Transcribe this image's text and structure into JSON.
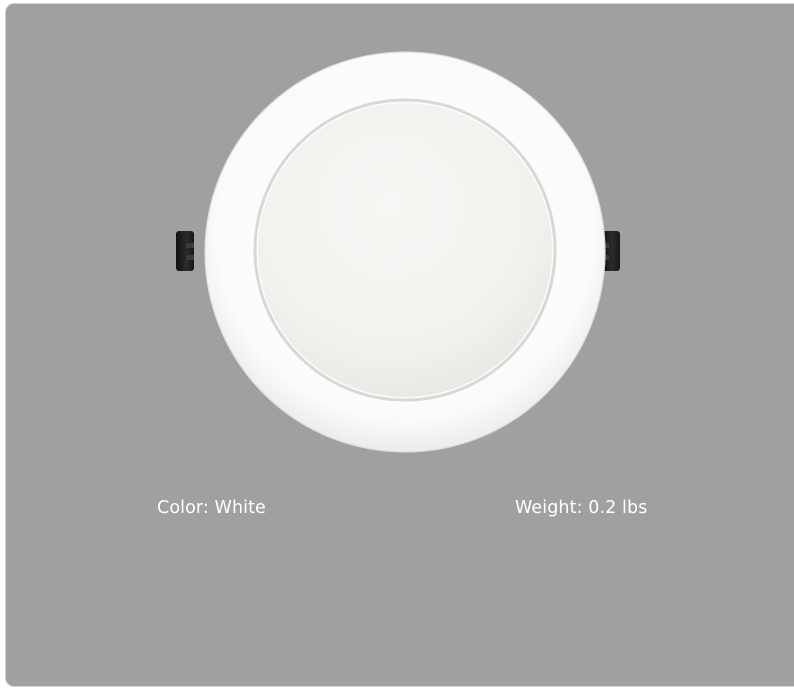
{
  "product": {
    "image_name": "round-led-recessed-downlight",
    "trim_color": "#ffffff",
    "lens_color": "#f2f2ef",
    "clip_color": "#1e1e1e"
  },
  "specs": {
    "color_text": "Color: White",
    "weight_text": "Weight: 0.2 lbs"
  },
  "colors": {
    "card_background": "#a0a0a0",
    "text": "#ffffff"
  }
}
